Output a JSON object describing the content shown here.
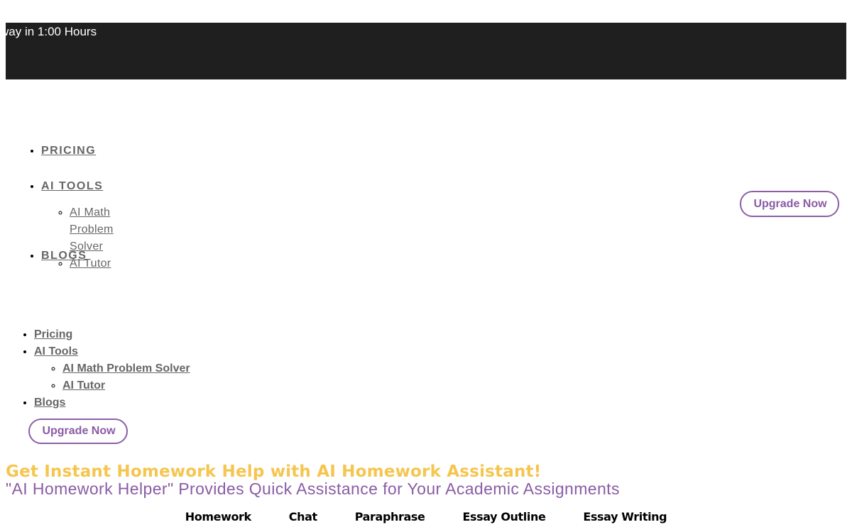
{
  "promo": {
    "text": "way in 1:00 Hours"
  },
  "nav_desktop": {
    "items": [
      {
        "label": "PRICING"
      },
      {
        "label": "AI TOOLS",
        "children": [
          {
            "label": "AI Math Problem Solver"
          },
          {
            "label": "AI Tutor"
          }
        ]
      },
      {
        "label": "BLOGS"
      }
    ],
    "upgrade_label": "Upgrade Now"
  },
  "nav_mobile": {
    "items": [
      {
        "label": "Pricing"
      },
      {
        "label": "AI Tools",
        "children": [
          {
            "label": "AI Math Problem Solver"
          },
          {
            "label": "AI Tutor"
          }
        ]
      },
      {
        "label": "Blogs"
      }
    ],
    "upgrade_label": "Upgrade Now"
  },
  "hero": {
    "title": "Get Instant Homework Help with AI Homework Assistant!",
    "subtitle": "\"AI Homework Helper\" Provides Quick Assistance for Your Academic Assignments"
  },
  "tool_tabs": [
    {
      "label": "Homework"
    },
    {
      "label": "Chat"
    },
    {
      "label": "Paraphrase"
    },
    {
      "label": "Essay Outline"
    },
    {
      "label": "Essay Writing"
    }
  ],
  "colors": {
    "promo_bg": "#1f1f1f",
    "accent_purple": "#8a5ca5",
    "accent_yellow": "#f5c54f",
    "link_gray": "#666666"
  }
}
